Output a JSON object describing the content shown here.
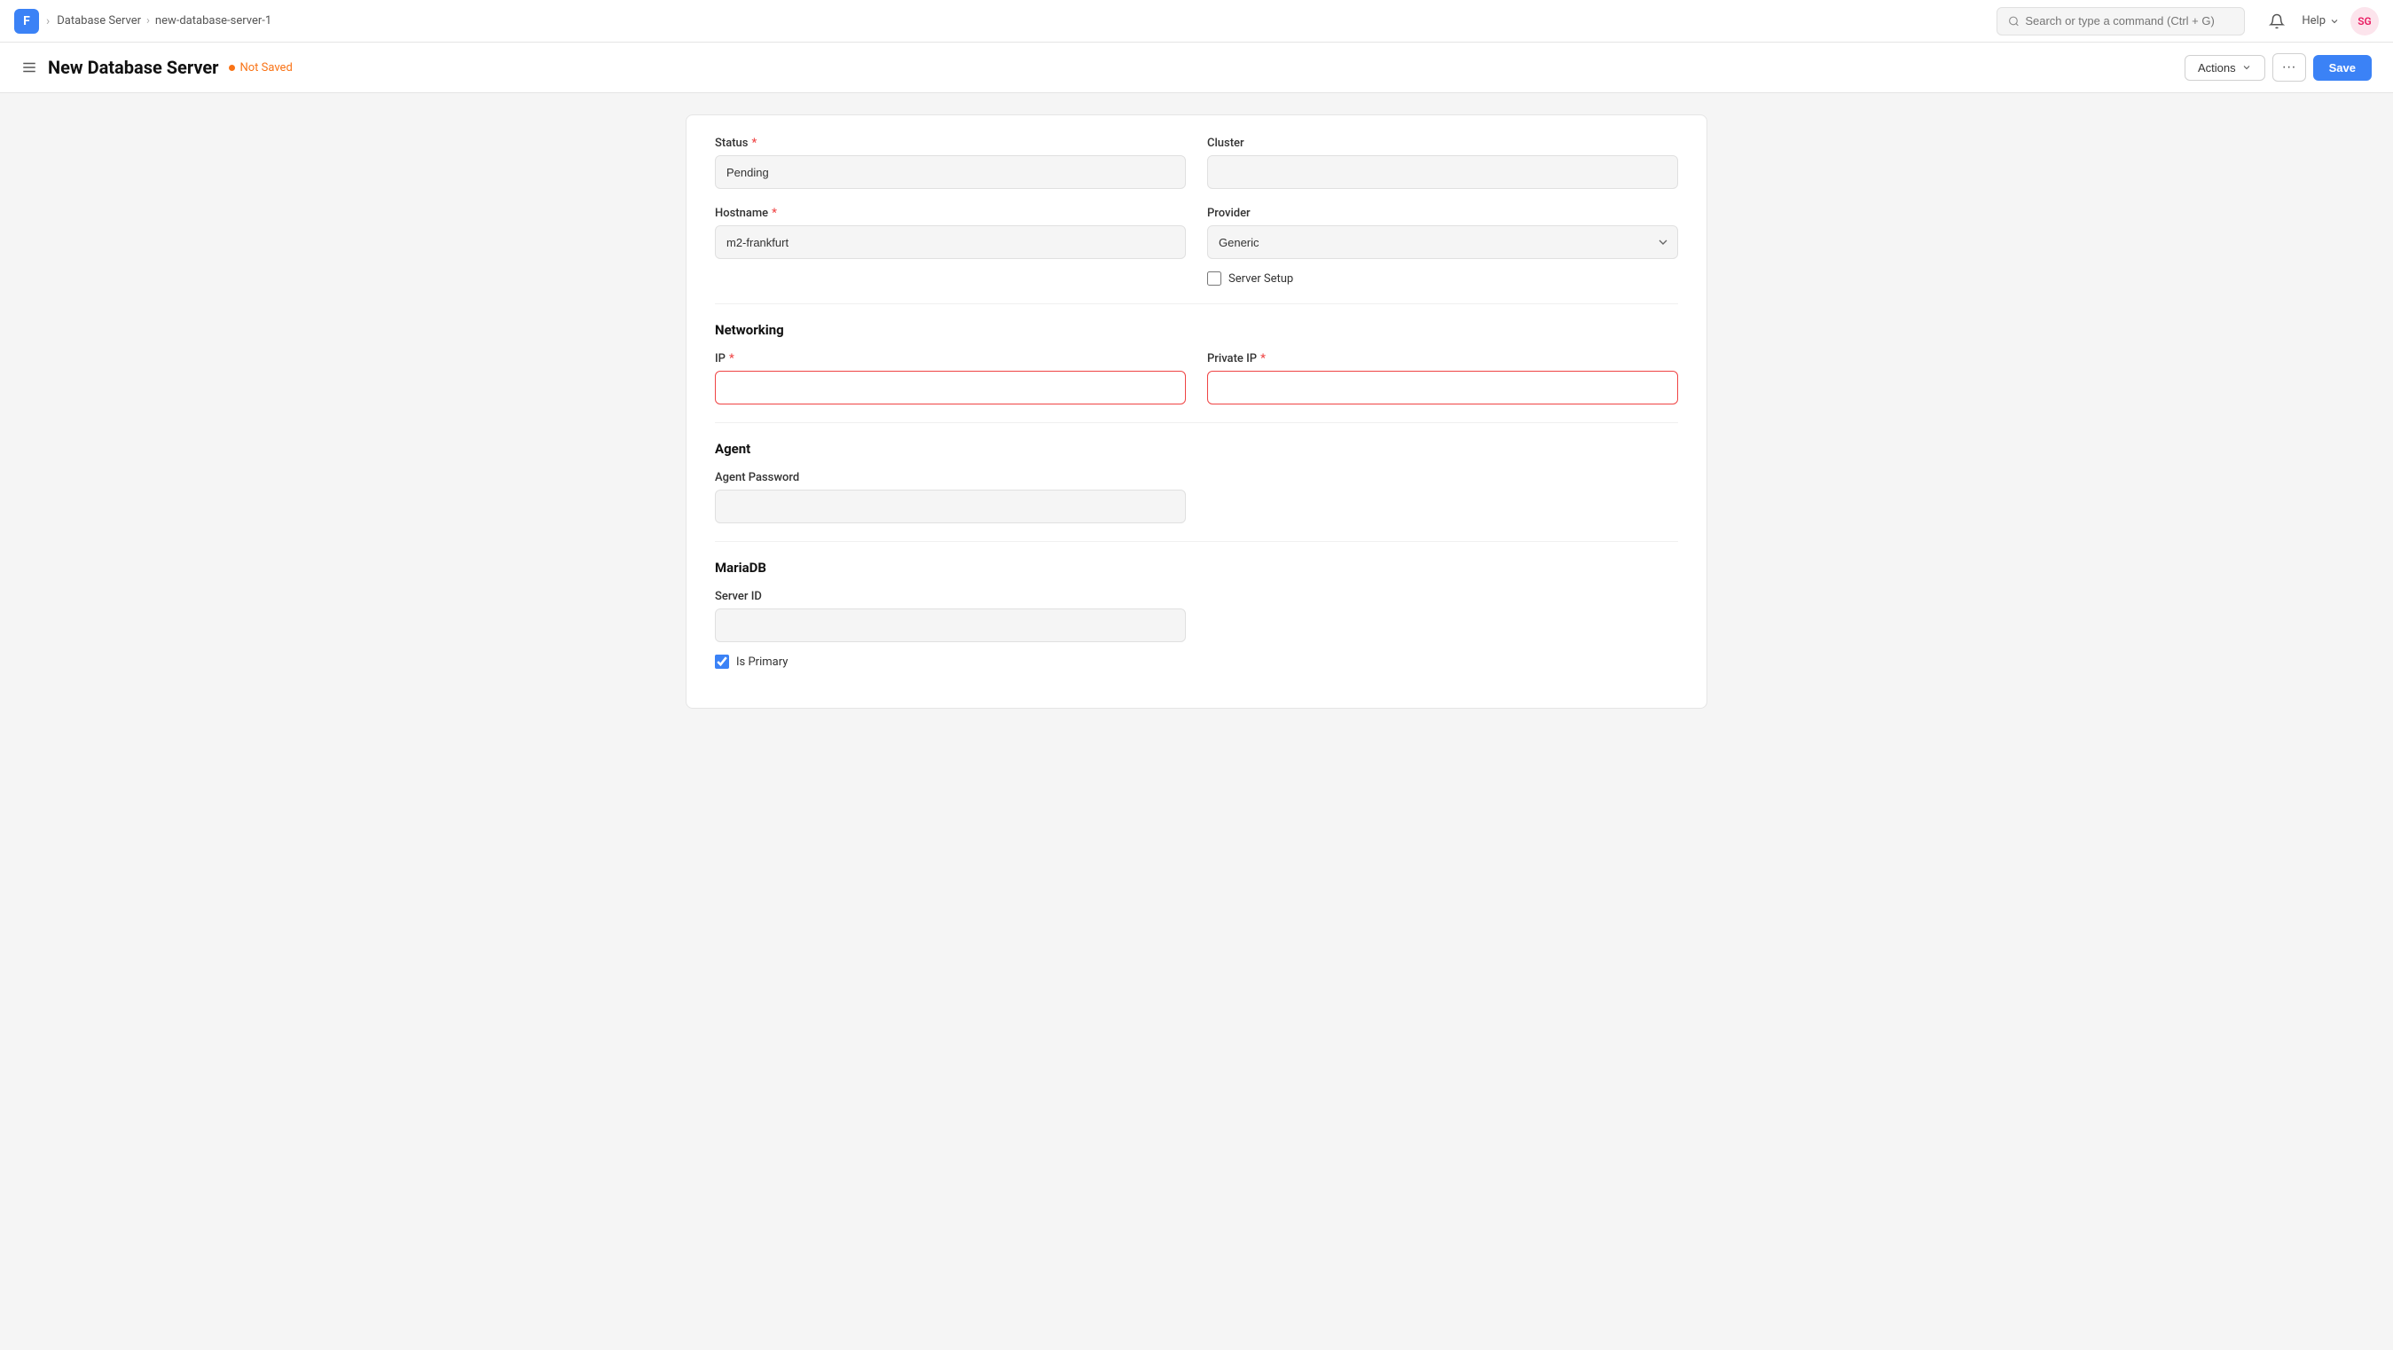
{
  "topnav": {
    "logo_letter": "F",
    "breadcrumb": [
      "Database Server",
      "new-database-server-1"
    ],
    "search_placeholder": "Search or type a command (Ctrl + G)",
    "help_label": "Help",
    "avatar_initials": "SG"
  },
  "page_header": {
    "title": "New Database Server",
    "not_saved_label": "Not Saved",
    "actions_label": "Actions",
    "save_label": "Save"
  },
  "form": {
    "status_label": "Status",
    "status_required": "*",
    "status_value": "Pending",
    "cluster_label": "Cluster",
    "cluster_value": "",
    "hostname_label": "Hostname",
    "hostname_required": "*",
    "hostname_value": "m2-frankfurt",
    "provider_label": "Provider",
    "provider_value": "Generic",
    "server_setup_label": "Server Setup",
    "networking_title": "Networking",
    "ip_label": "IP",
    "ip_required": "*",
    "ip_value": "",
    "private_ip_label": "Private IP",
    "private_ip_required": "*",
    "private_ip_value": "",
    "agent_title": "Agent",
    "agent_password_label": "Agent Password",
    "agent_password_value": "",
    "mariadb_title": "MariaDB",
    "server_id_label": "Server ID",
    "server_id_value": "",
    "is_primary_label": "Is Primary",
    "is_primary_checked": true
  }
}
